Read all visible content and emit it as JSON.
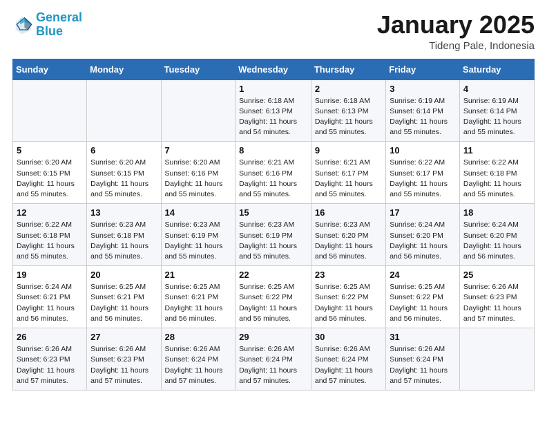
{
  "header": {
    "logo_line1": "General",
    "logo_line2": "Blue",
    "month_title": "January 2025",
    "subtitle": "Tideng Pale, Indonesia"
  },
  "weekdays": [
    "Sunday",
    "Monday",
    "Tuesday",
    "Wednesday",
    "Thursday",
    "Friday",
    "Saturday"
  ],
  "weeks": [
    [
      {
        "day": "",
        "info": ""
      },
      {
        "day": "",
        "info": ""
      },
      {
        "day": "",
        "info": ""
      },
      {
        "day": "1",
        "info": "Sunrise: 6:18 AM\nSunset: 6:13 PM\nDaylight: 11 hours\nand 54 minutes."
      },
      {
        "day": "2",
        "info": "Sunrise: 6:18 AM\nSunset: 6:13 PM\nDaylight: 11 hours\nand 55 minutes."
      },
      {
        "day": "3",
        "info": "Sunrise: 6:19 AM\nSunset: 6:14 PM\nDaylight: 11 hours\nand 55 minutes."
      },
      {
        "day": "4",
        "info": "Sunrise: 6:19 AM\nSunset: 6:14 PM\nDaylight: 11 hours\nand 55 minutes."
      }
    ],
    [
      {
        "day": "5",
        "info": "Sunrise: 6:20 AM\nSunset: 6:15 PM\nDaylight: 11 hours\nand 55 minutes."
      },
      {
        "day": "6",
        "info": "Sunrise: 6:20 AM\nSunset: 6:15 PM\nDaylight: 11 hours\nand 55 minutes."
      },
      {
        "day": "7",
        "info": "Sunrise: 6:20 AM\nSunset: 6:16 PM\nDaylight: 11 hours\nand 55 minutes."
      },
      {
        "day": "8",
        "info": "Sunrise: 6:21 AM\nSunset: 6:16 PM\nDaylight: 11 hours\nand 55 minutes."
      },
      {
        "day": "9",
        "info": "Sunrise: 6:21 AM\nSunset: 6:17 PM\nDaylight: 11 hours\nand 55 minutes."
      },
      {
        "day": "10",
        "info": "Sunrise: 6:22 AM\nSunset: 6:17 PM\nDaylight: 11 hours\nand 55 minutes."
      },
      {
        "day": "11",
        "info": "Sunrise: 6:22 AM\nSunset: 6:18 PM\nDaylight: 11 hours\nand 55 minutes."
      }
    ],
    [
      {
        "day": "12",
        "info": "Sunrise: 6:22 AM\nSunset: 6:18 PM\nDaylight: 11 hours\nand 55 minutes."
      },
      {
        "day": "13",
        "info": "Sunrise: 6:23 AM\nSunset: 6:18 PM\nDaylight: 11 hours\nand 55 minutes."
      },
      {
        "day": "14",
        "info": "Sunrise: 6:23 AM\nSunset: 6:19 PM\nDaylight: 11 hours\nand 55 minutes."
      },
      {
        "day": "15",
        "info": "Sunrise: 6:23 AM\nSunset: 6:19 PM\nDaylight: 11 hours\nand 55 minutes."
      },
      {
        "day": "16",
        "info": "Sunrise: 6:23 AM\nSunset: 6:20 PM\nDaylight: 11 hours\nand 56 minutes."
      },
      {
        "day": "17",
        "info": "Sunrise: 6:24 AM\nSunset: 6:20 PM\nDaylight: 11 hours\nand 56 minutes."
      },
      {
        "day": "18",
        "info": "Sunrise: 6:24 AM\nSunset: 6:20 PM\nDaylight: 11 hours\nand 56 minutes."
      }
    ],
    [
      {
        "day": "19",
        "info": "Sunrise: 6:24 AM\nSunset: 6:21 PM\nDaylight: 11 hours\nand 56 minutes."
      },
      {
        "day": "20",
        "info": "Sunrise: 6:25 AM\nSunset: 6:21 PM\nDaylight: 11 hours\nand 56 minutes."
      },
      {
        "day": "21",
        "info": "Sunrise: 6:25 AM\nSunset: 6:21 PM\nDaylight: 11 hours\nand 56 minutes."
      },
      {
        "day": "22",
        "info": "Sunrise: 6:25 AM\nSunset: 6:22 PM\nDaylight: 11 hours\nand 56 minutes."
      },
      {
        "day": "23",
        "info": "Sunrise: 6:25 AM\nSunset: 6:22 PM\nDaylight: 11 hours\nand 56 minutes."
      },
      {
        "day": "24",
        "info": "Sunrise: 6:25 AM\nSunset: 6:22 PM\nDaylight: 11 hours\nand 56 minutes."
      },
      {
        "day": "25",
        "info": "Sunrise: 6:26 AM\nSunset: 6:23 PM\nDaylight: 11 hours\nand 57 minutes."
      }
    ],
    [
      {
        "day": "26",
        "info": "Sunrise: 6:26 AM\nSunset: 6:23 PM\nDaylight: 11 hours\nand 57 minutes."
      },
      {
        "day": "27",
        "info": "Sunrise: 6:26 AM\nSunset: 6:23 PM\nDaylight: 11 hours\nand 57 minutes."
      },
      {
        "day": "28",
        "info": "Sunrise: 6:26 AM\nSunset: 6:24 PM\nDaylight: 11 hours\nand 57 minutes."
      },
      {
        "day": "29",
        "info": "Sunrise: 6:26 AM\nSunset: 6:24 PM\nDaylight: 11 hours\nand 57 minutes."
      },
      {
        "day": "30",
        "info": "Sunrise: 6:26 AM\nSunset: 6:24 PM\nDaylight: 11 hours\nand 57 minutes."
      },
      {
        "day": "31",
        "info": "Sunrise: 6:26 AM\nSunset: 6:24 PM\nDaylight: 11 hours\nand 57 minutes."
      },
      {
        "day": "",
        "info": ""
      }
    ]
  ]
}
